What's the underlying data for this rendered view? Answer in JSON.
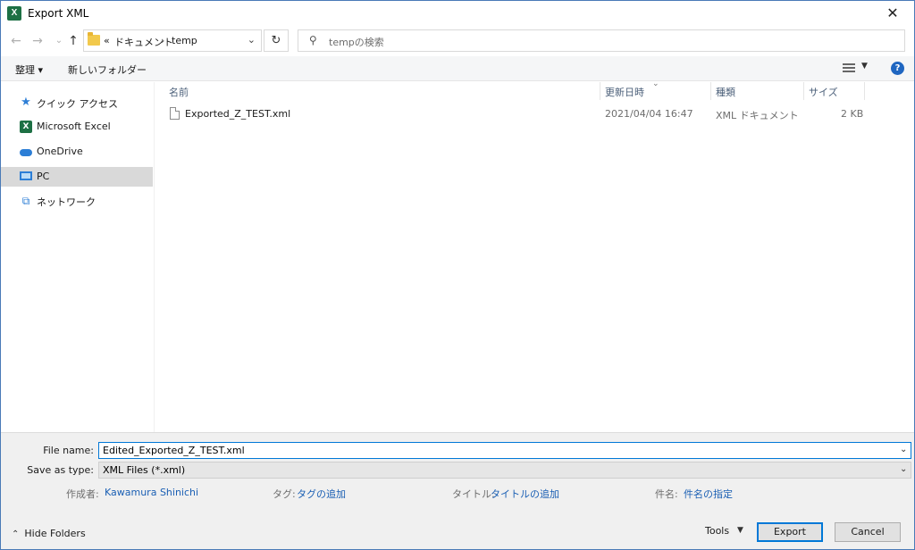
{
  "window": {
    "title": "Export XML",
    "app_icon_letter": "X",
    "close_glyph": "✕"
  },
  "nav": {
    "back_glyph": "←",
    "forward_glyph": "→",
    "recent_glyph": "⌄",
    "up_glyph": "↑",
    "breadcrumb": {
      "overflow": "«",
      "items": [
        "ドキュメント",
        "temp"
      ],
      "separator": "›"
    },
    "address_dropdown_glyph": "⌄",
    "refresh_glyph": "↻",
    "search_placeholder": "tempの検索"
  },
  "toolbar": {
    "organize_label": "整理 ▾",
    "new_folder_label": "新しいフォルダー",
    "help_glyph": "?"
  },
  "sidebar": {
    "items": [
      {
        "label": "クイック アクセス",
        "icon": "star-icon",
        "selected": false
      },
      {
        "label": "Microsoft Excel",
        "icon": "excel-icon",
        "selected": false
      },
      {
        "label": "OneDrive",
        "icon": "cloud-icon",
        "selected": false
      },
      {
        "label": "PC",
        "icon": "computer-icon",
        "selected": true
      },
      {
        "label": "ネットワーク",
        "icon": "network-icon",
        "selected": false
      }
    ]
  },
  "filelist": {
    "columns": [
      "名前",
      "更新日時",
      "種類",
      "サイズ"
    ],
    "rows": [
      {
        "name": "Exported_Z_TEST.xml",
        "modified": "2021/04/04 16:47",
        "type": "XML ドキュメント",
        "size": "2 KB"
      }
    ]
  },
  "form": {
    "filename_label": "File name:",
    "filename_value": "Edited_Exported_Z_TEST.xml",
    "savetype_label": "Save as type:",
    "savetype_value": "XML Files (*.xml)",
    "meta": {
      "author_label": "作成者:",
      "author_value": "Kawamura Shinichi",
      "tags_label": "タグ:",
      "tags_value": "タグの追加",
      "title_label": "タイトル:",
      "title_value": "タイトルの追加",
      "subject_label": "件名:",
      "subject_value": "件名の指定"
    }
  },
  "footer": {
    "hide_folders_label": "Hide Folders",
    "tools_label": "Tools",
    "export_label": "Export",
    "cancel_label": "Cancel"
  },
  "colors": {
    "accent": "#0078d7",
    "link": "#1a5fb4",
    "excel_green": "#1d7044",
    "selected_bg": "#d9d9d9"
  }
}
